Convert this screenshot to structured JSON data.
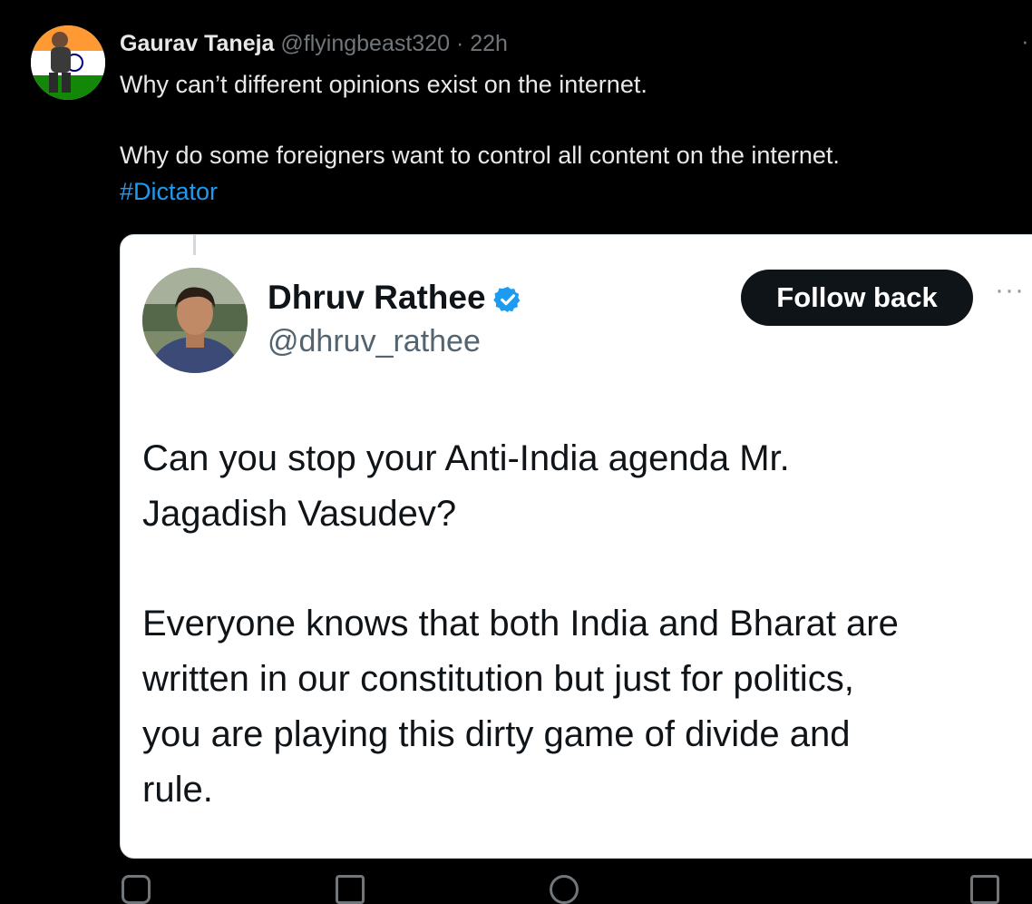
{
  "tweet": {
    "author_name": "Gaurav Taneja",
    "handle": "@flyingbeast320",
    "separator": "·",
    "time": "22h",
    "line1": "Why can’t different opinions exist on the internet.",
    "line2": "Why do some foreigners want to control all content on the internet.",
    "hashtag": "#Dictator",
    "more_icon": "more-icon"
  },
  "quote": {
    "name": "Dhruv Rathee",
    "handle": "@dhruv_rathee",
    "verified_icon": "verified-badge-icon",
    "follow_label": "Follow back",
    "more_icon": "more-icon",
    "para1_line1": "Can you stop your Anti-India agenda Mr.",
    "para1_line2": "Jagadish Vasudev?",
    "para2_line1": "Everyone knows that both India and Bharat are",
    "para2_line2": "written in our constitution but just for politics,",
    "para2_line3": "you are playing this dirty game of divide and",
    "para2_line4": "rule."
  },
  "colors": {
    "background": "#000000",
    "text": "#e7e9ea",
    "muted": "#71767b",
    "link": "#1d9bf0",
    "verified": "#1d9bf0",
    "follow_bg": "#0f1419"
  }
}
